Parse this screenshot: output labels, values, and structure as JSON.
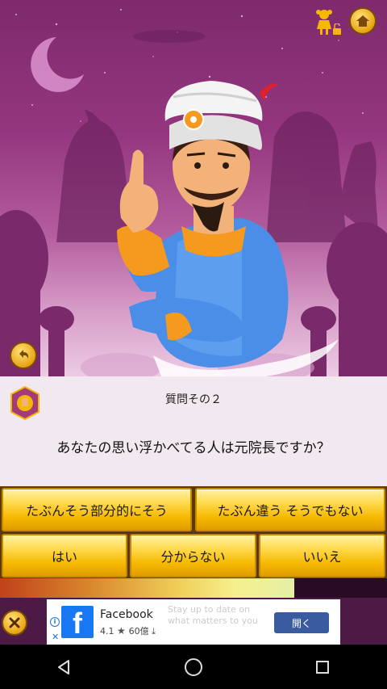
{
  "question": {
    "number_label": "質問その２",
    "text": "あなたの思い浮かべてる人は元院長ですか？"
  },
  "answers": {
    "probably": "たぶんそう部分的にそう",
    "probably_not": "たぶん違う そうでもない",
    "yes": "はい",
    "dont_know": "分からない",
    "no": "いいえ"
  },
  "progress": {
    "fraction": 0.76
  },
  "ad": {
    "app_name": "Facebook",
    "rating": "4.1",
    "downloads": "60億",
    "open_label": "開く",
    "ghost_text": "Stay up to date on what matters to you with thoughts and"
  },
  "colors": {
    "accent_gold": "#f5b800",
    "scene_purple": "#94367f",
    "ad_button": "#3b5ba0"
  },
  "icons": [
    "home-icon",
    "girl-icon",
    "unlock-icon",
    "undo-icon",
    "close-icon",
    "back-icon",
    "home-circle-icon",
    "recents-icon"
  ]
}
